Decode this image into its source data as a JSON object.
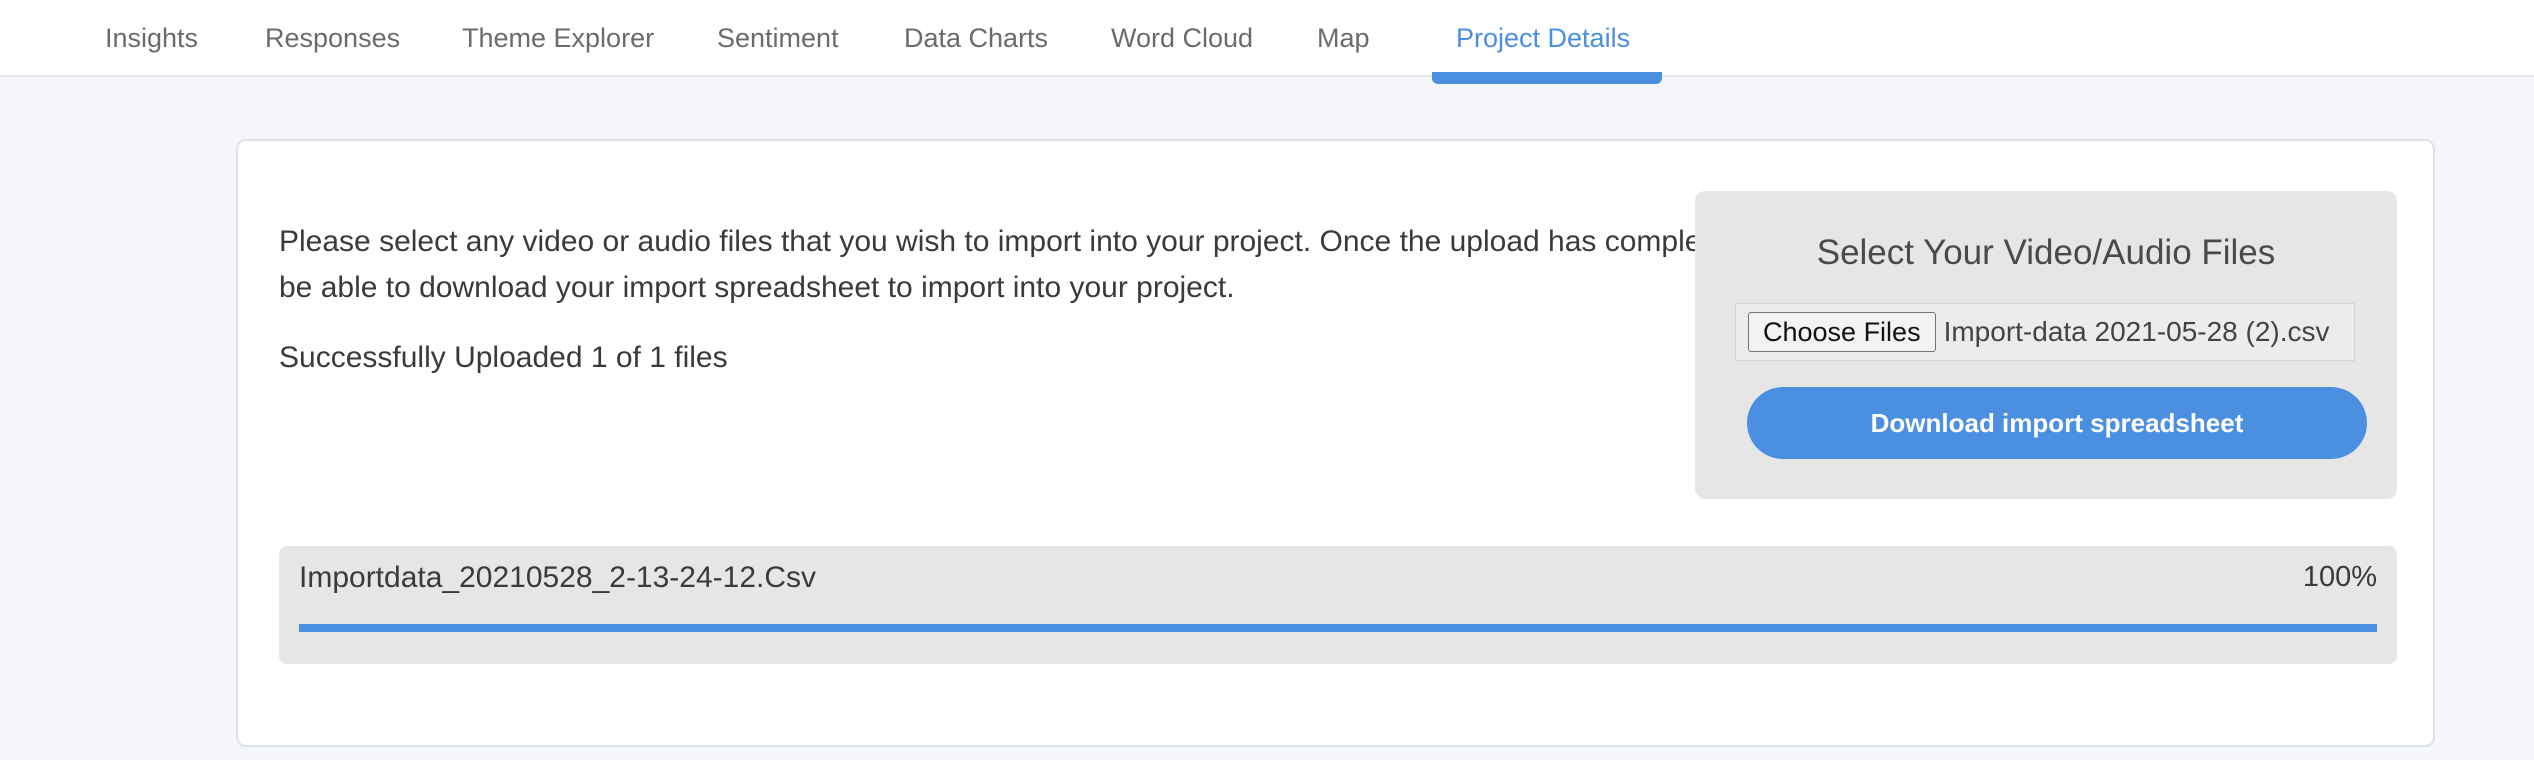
{
  "nav": {
    "tabs": [
      {
        "label": "Insights"
      },
      {
        "label": "Responses"
      },
      {
        "label": "Theme Explorer"
      },
      {
        "label": "Sentiment"
      },
      {
        "label": "Data Charts"
      },
      {
        "label": "Word Cloud"
      },
      {
        "label": "Map"
      },
      {
        "label": "Project Details",
        "active": true
      }
    ]
  },
  "content": {
    "intro": "Please select any video or audio files that you wish to import into your project. Once the upload has completed, you will be able to download your import spreadsheet to import into your project.",
    "status": "Successfully Uploaded 1 of 1 files"
  },
  "upload": {
    "title": "Select Your Video/Audio Files",
    "choose_label": "Choose Files",
    "file_name": "Import-data 2021-05-28 (2).csv",
    "download_label": "Download import spreadsheet"
  },
  "progress": {
    "file_name": "Importdata_20210528_2-13-24-12.Csv",
    "percent_label": "100%",
    "percent": 100
  },
  "colors": {
    "accent": "#4a8fe0",
    "panel": "#e6e6e6"
  }
}
